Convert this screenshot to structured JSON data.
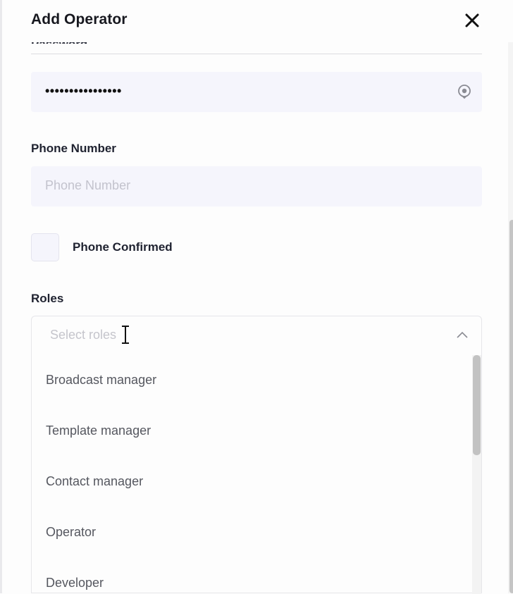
{
  "modal": {
    "title": "Add Operator",
    "close_icon": "close-icon"
  },
  "form": {
    "password": {
      "label": "Password",
      "value": "••••••••••••••••",
      "toggle_icon": "eye-icon"
    },
    "phone_number": {
      "label": "Phone Number",
      "placeholder": "Phone Number",
      "value": ""
    },
    "phone_confirmed": {
      "label": "Phone Confirmed",
      "checked": false
    },
    "roles": {
      "label": "Roles",
      "placeholder": "Select roles",
      "expanded": true,
      "options": [
        "Broadcast manager",
        "Template manager",
        "Contact manager",
        "Operator",
        "Developer"
      ]
    }
  },
  "colors": {
    "input_bg": "#f5f5fc",
    "text": "#1f2230",
    "placeholder": "#c3c3cd",
    "option_text": "#55575f"
  }
}
